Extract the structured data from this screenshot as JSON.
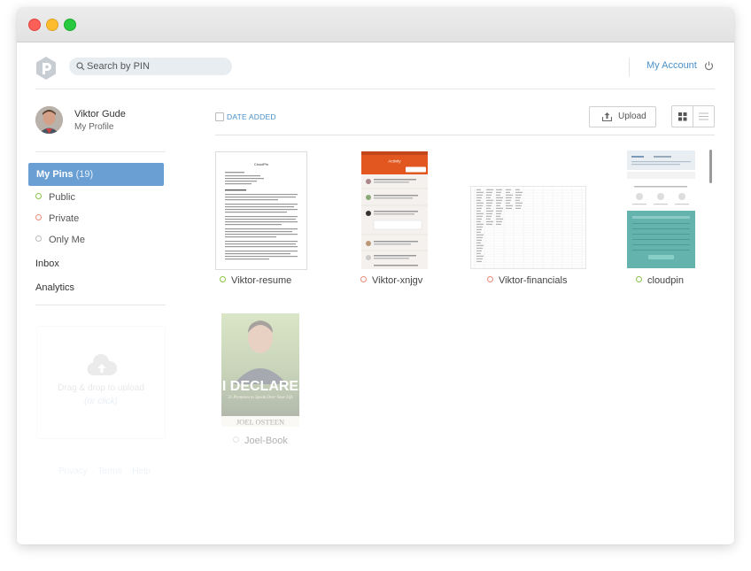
{
  "search": {
    "placeholder": "Search by PIN"
  },
  "header": {
    "account_label": "My Account"
  },
  "user": {
    "name": "Viktor Gude",
    "profile_label": "My Profile"
  },
  "sidebar": {
    "my_pins_label": "My Pins",
    "my_pins_count": "(19)",
    "visibility": [
      {
        "label": "Public",
        "color": "#8bc34a"
      },
      {
        "label": "Private",
        "color": "#ef8a7a"
      },
      {
        "label": "Only Me",
        "color": "#bbbbbb"
      }
    ],
    "nav": [
      {
        "label": "Inbox"
      },
      {
        "label": "Analytics"
      }
    ]
  },
  "dropzone": {
    "text": "Drag & drop to upload",
    "click_text": "(or click)"
  },
  "footer": {
    "links": [
      "Privacy",
      "Terms",
      "Help"
    ]
  },
  "toolbar": {
    "sort_label": "DATE ADDED",
    "upload_label": "Upload"
  },
  "pins": [
    {
      "name": "Viktor-resume",
      "status_color": "#8bc34a",
      "thumb": "document",
      "doc_title": "CloudPin"
    },
    {
      "name": "Viktor-xnjgv",
      "status_color": "#ef8a7a",
      "thumb": "mobile-app",
      "app_title": "Activity"
    },
    {
      "name": "Viktor-financials",
      "status_color": "#ef8a7a",
      "thumb": "spreadsheet"
    },
    {
      "name": "cloudpin",
      "status_color": "#8bc34a",
      "thumb": "website"
    },
    {
      "name": "Joel-Book",
      "status_color": "#bbbbbb",
      "thumb": "book-cover",
      "book_title": "I DECLARE",
      "book_subtitle": "31 Promises to Speak Over Your Life",
      "book_author": "JOEL OSTEEN"
    }
  ]
}
